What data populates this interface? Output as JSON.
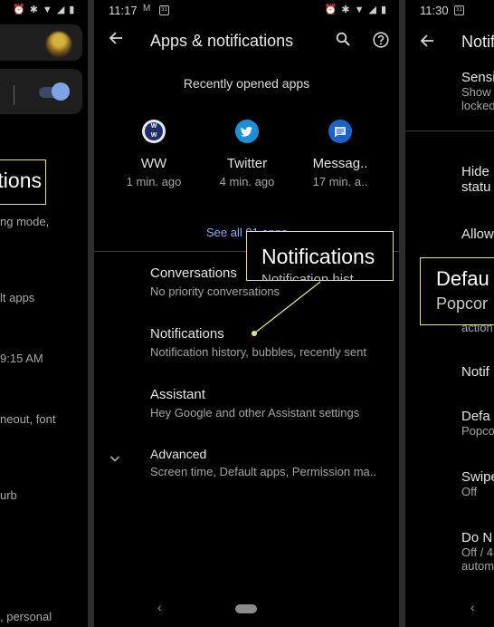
{
  "left_panel": {
    "rows": [
      {
        "text": "ng mode,"
      },
      {
        "text": "lt apps"
      },
      {
        "text": "9:15 AM"
      },
      {
        "text": "neout, font"
      },
      {
        "text": "urb"
      },
      {
        "text": ", personal"
      }
    ],
    "callout_label": "tions",
    "toggle_on": true
  },
  "middle_panel": {
    "status_bar": {
      "time": "11:17"
    },
    "header": {
      "title": "Apps & notifications",
      "back_icon": "arrow-left-icon",
      "search_icon": "search-icon",
      "help_icon": "help-circle-icon"
    },
    "recent": {
      "section_title": "Recently opened apps",
      "apps": [
        {
          "name": "WW",
          "time": "1 min. ago",
          "icon": "ww-app-icon",
          "color": "#1f2e6e"
        },
        {
          "name": "Twitter",
          "time": "4 min. ago",
          "icon": "twitter-app-icon",
          "color": "#1d8fd8"
        },
        {
          "name": "Messag..",
          "time": "17 min. a..",
          "icon": "messages-app-icon",
          "color": "#1a63c9"
        }
      ],
      "see_all_label": "See all 91 apps"
    },
    "items": [
      {
        "title": "Conversations",
        "subtitle": "No priority conversations"
      },
      {
        "title": "Notifications",
        "subtitle": "Notification history, bubbles, recently sent"
      },
      {
        "title": "Assistant",
        "subtitle": "Hey Google and other Assistant settings"
      },
      {
        "title": "Advanced",
        "subtitle": "Screen time, Default apps, Permission ma.."
      }
    ],
    "callout_label": "Notifications",
    "callout_ghost": "Notification hist"
  },
  "right_panel": {
    "status_bar": {
      "time": "11:30"
    },
    "header_title": "Notif",
    "rows": [
      {
        "title": "Sensi",
        "subtitle": "Show",
        "subtitle2": "locked"
      },
      {
        "title": "Hide",
        "subtitle": "statu"
      },
      {
        "title": "Allow"
      },
      {
        "title": "Notif"
      },
      {
        "title": "Defa",
        "subtitle": "Popco"
      },
      {
        "title": "Swipe",
        "subtitle": "Off"
      },
      {
        "title": "Do N",
        "subtitle": "Off / 4",
        "subtitle2": "autom"
      }
    ],
    "callout_title": "Defau",
    "callout_sub": "Popcor",
    "callout_ghost": "action"
  },
  "colors": {
    "callout_border": "#e6e08a",
    "link": "#8ab0f2",
    "toggle_thumb": "#7fa2e6"
  }
}
